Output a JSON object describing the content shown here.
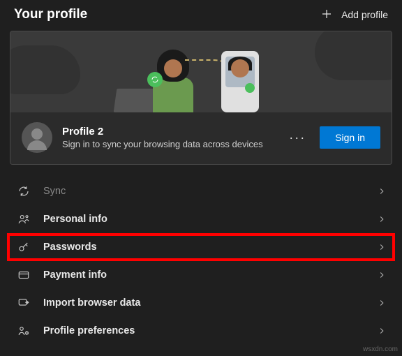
{
  "header": {
    "title": "Your profile",
    "add_profile_label": "Add profile"
  },
  "profile": {
    "name": "Profile 2",
    "description": "Sign in to sync your browsing data across devices",
    "more_label": "···",
    "signin_label": "Sign in"
  },
  "menu": {
    "items": [
      {
        "icon": "sync-icon",
        "label": "Sync",
        "enabled": false,
        "highlighted": false
      },
      {
        "icon": "person-icon",
        "label": "Personal info",
        "enabled": true,
        "highlighted": false
      },
      {
        "icon": "key-icon",
        "label": "Passwords",
        "enabled": true,
        "highlighted": true
      },
      {
        "icon": "card-icon",
        "label": "Payment info",
        "enabled": true,
        "highlighted": false
      },
      {
        "icon": "import-icon",
        "label": "Import browser data",
        "enabled": true,
        "highlighted": false
      },
      {
        "icon": "prefs-icon",
        "label": "Profile preferences",
        "enabled": true,
        "highlighted": false
      }
    ]
  },
  "watermark": "wsxdn.com"
}
